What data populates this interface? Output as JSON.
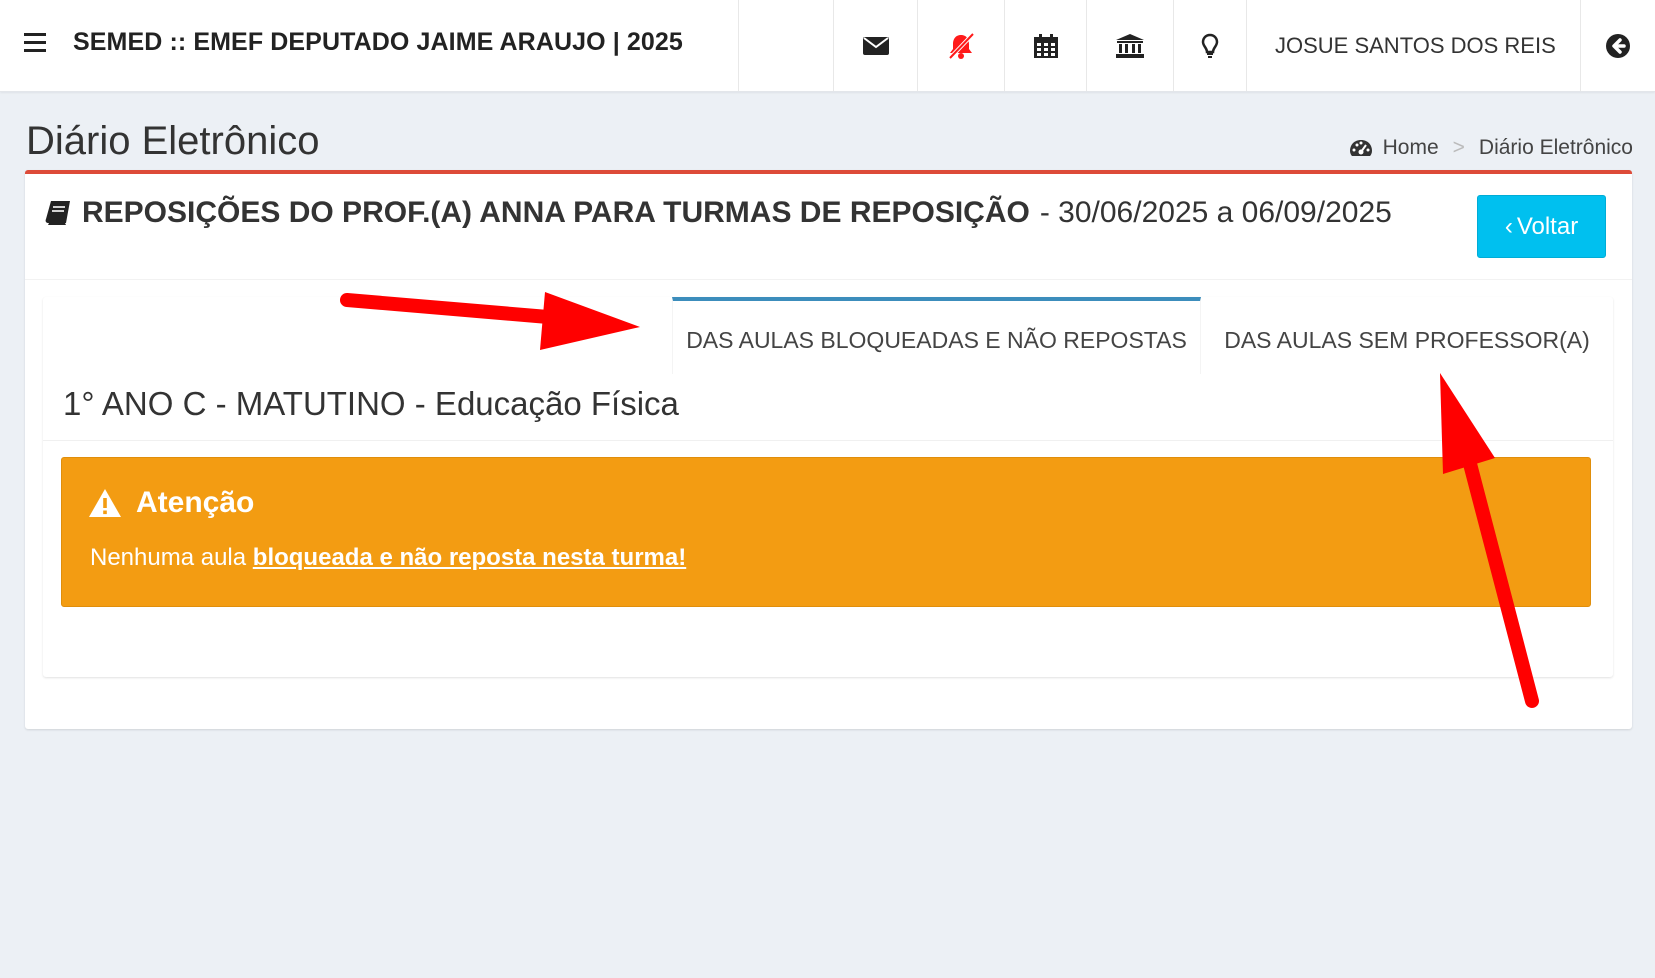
{
  "header": {
    "app_title": "SEMED :: EMEF DEPUTADO JAIME ARAUJO | 2025",
    "user_name": "JOSUE SANTOS DOS REIS",
    "icons": [
      "menu-icon",
      "envelope-icon",
      "bell-slash-icon",
      "calendar-icon",
      "institution-icon",
      "lightbulb-icon",
      "sign-out-icon"
    ],
    "alert_icon_color": "#ff1a1a"
  },
  "page": {
    "title": "Diário Eletrônico",
    "breadcrumb": {
      "home": "Home",
      "separator": ">",
      "current": "Diário Eletrônico"
    }
  },
  "box": {
    "title_bold": "REPOSIÇÕES DO PROF.(A) ANNA PARA TURMAS DE REPOSIÇÃO",
    "title_dates": "- 30/06/2025 a 06/09/2025",
    "back_button": "Voltar",
    "accent_color": "#dd4b39",
    "button_color": "#00c0ef"
  },
  "tabs": [
    {
      "label": "DAS AULAS BLOQUEADAS E NÃO REPOSTAS",
      "active": true
    },
    {
      "label": "DAS AULAS SEM PROFESSOR(A)",
      "active": false
    }
  ],
  "class_heading": "1° ANO C - MATUTINO - Educação Física",
  "alert": {
    "title": "Atenção",
    "message_prefix": "Nenhuma aula ",
    "message_link": "bloqueada e não reposta nesta turma!",
    "color": "#f39c12"
  },
  "annotations": {
    "arrow_color": "#ff0000"
  }
}
